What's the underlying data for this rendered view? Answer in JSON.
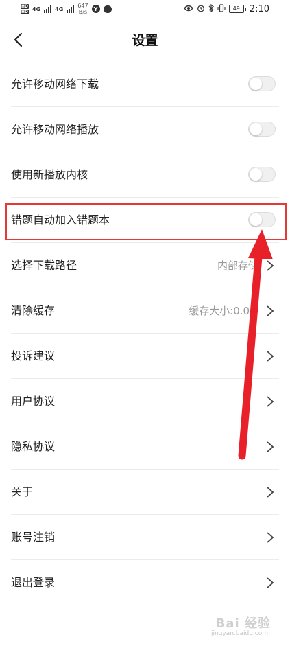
{
  "status_bar": {
    "hd_top": "HD",
    "hd_bottom": "HD",
    "net1": "4G",
    "net2": "4G",
    "speed_value": "647",
    "speed_unit": "B/s",
    "app_badge": "Y",
    "battery": "49",
    "time": "2:10"
  },
  "header": {
    "title": "设置"
  },
  "settings": {
    "mobile_download": {
      "label": "允许移动网络下载",
      "enabled": false
    },
    "mobile_play": {
      "label": "允许移动网络播放",
      "enabled": false
    },
    "new_player_core": {
      "label": "使用新播放内核",
      "enabled": false
    },
    "wrong_to_notebook": {
      "label": "错题自动加入错题本",
      "enabled": false
    },
    "download_path": {
      "label": "选择下载路径",
      "value": "内部存储"
    },
    "clear_cache": {
      "label": "清除缓存",
      "value": "缓存大小:0.0M"
    },
    "feedback": {
      "label": "投诉建议"
    },
    "user_agreement": {
      "label": "用户协议"
    },
    "privacy": {
      "label": "隐私协议"
    },
    "about": {
      "label": "关于"
    },
    "account_cancel": {
      "label": "账号注销"
    },
    "logout": {
      "label": "退出登录"
    }
  },
  "colors": {
    "annotation_red": "#e53935",
    "toggle_off": "#f0f0f0",
    "value_gray": "#999999"
  },
  "watermark": {
    "text": "Bai 经验",
    "sub": "jingyan.baidu.com"
  }
}
